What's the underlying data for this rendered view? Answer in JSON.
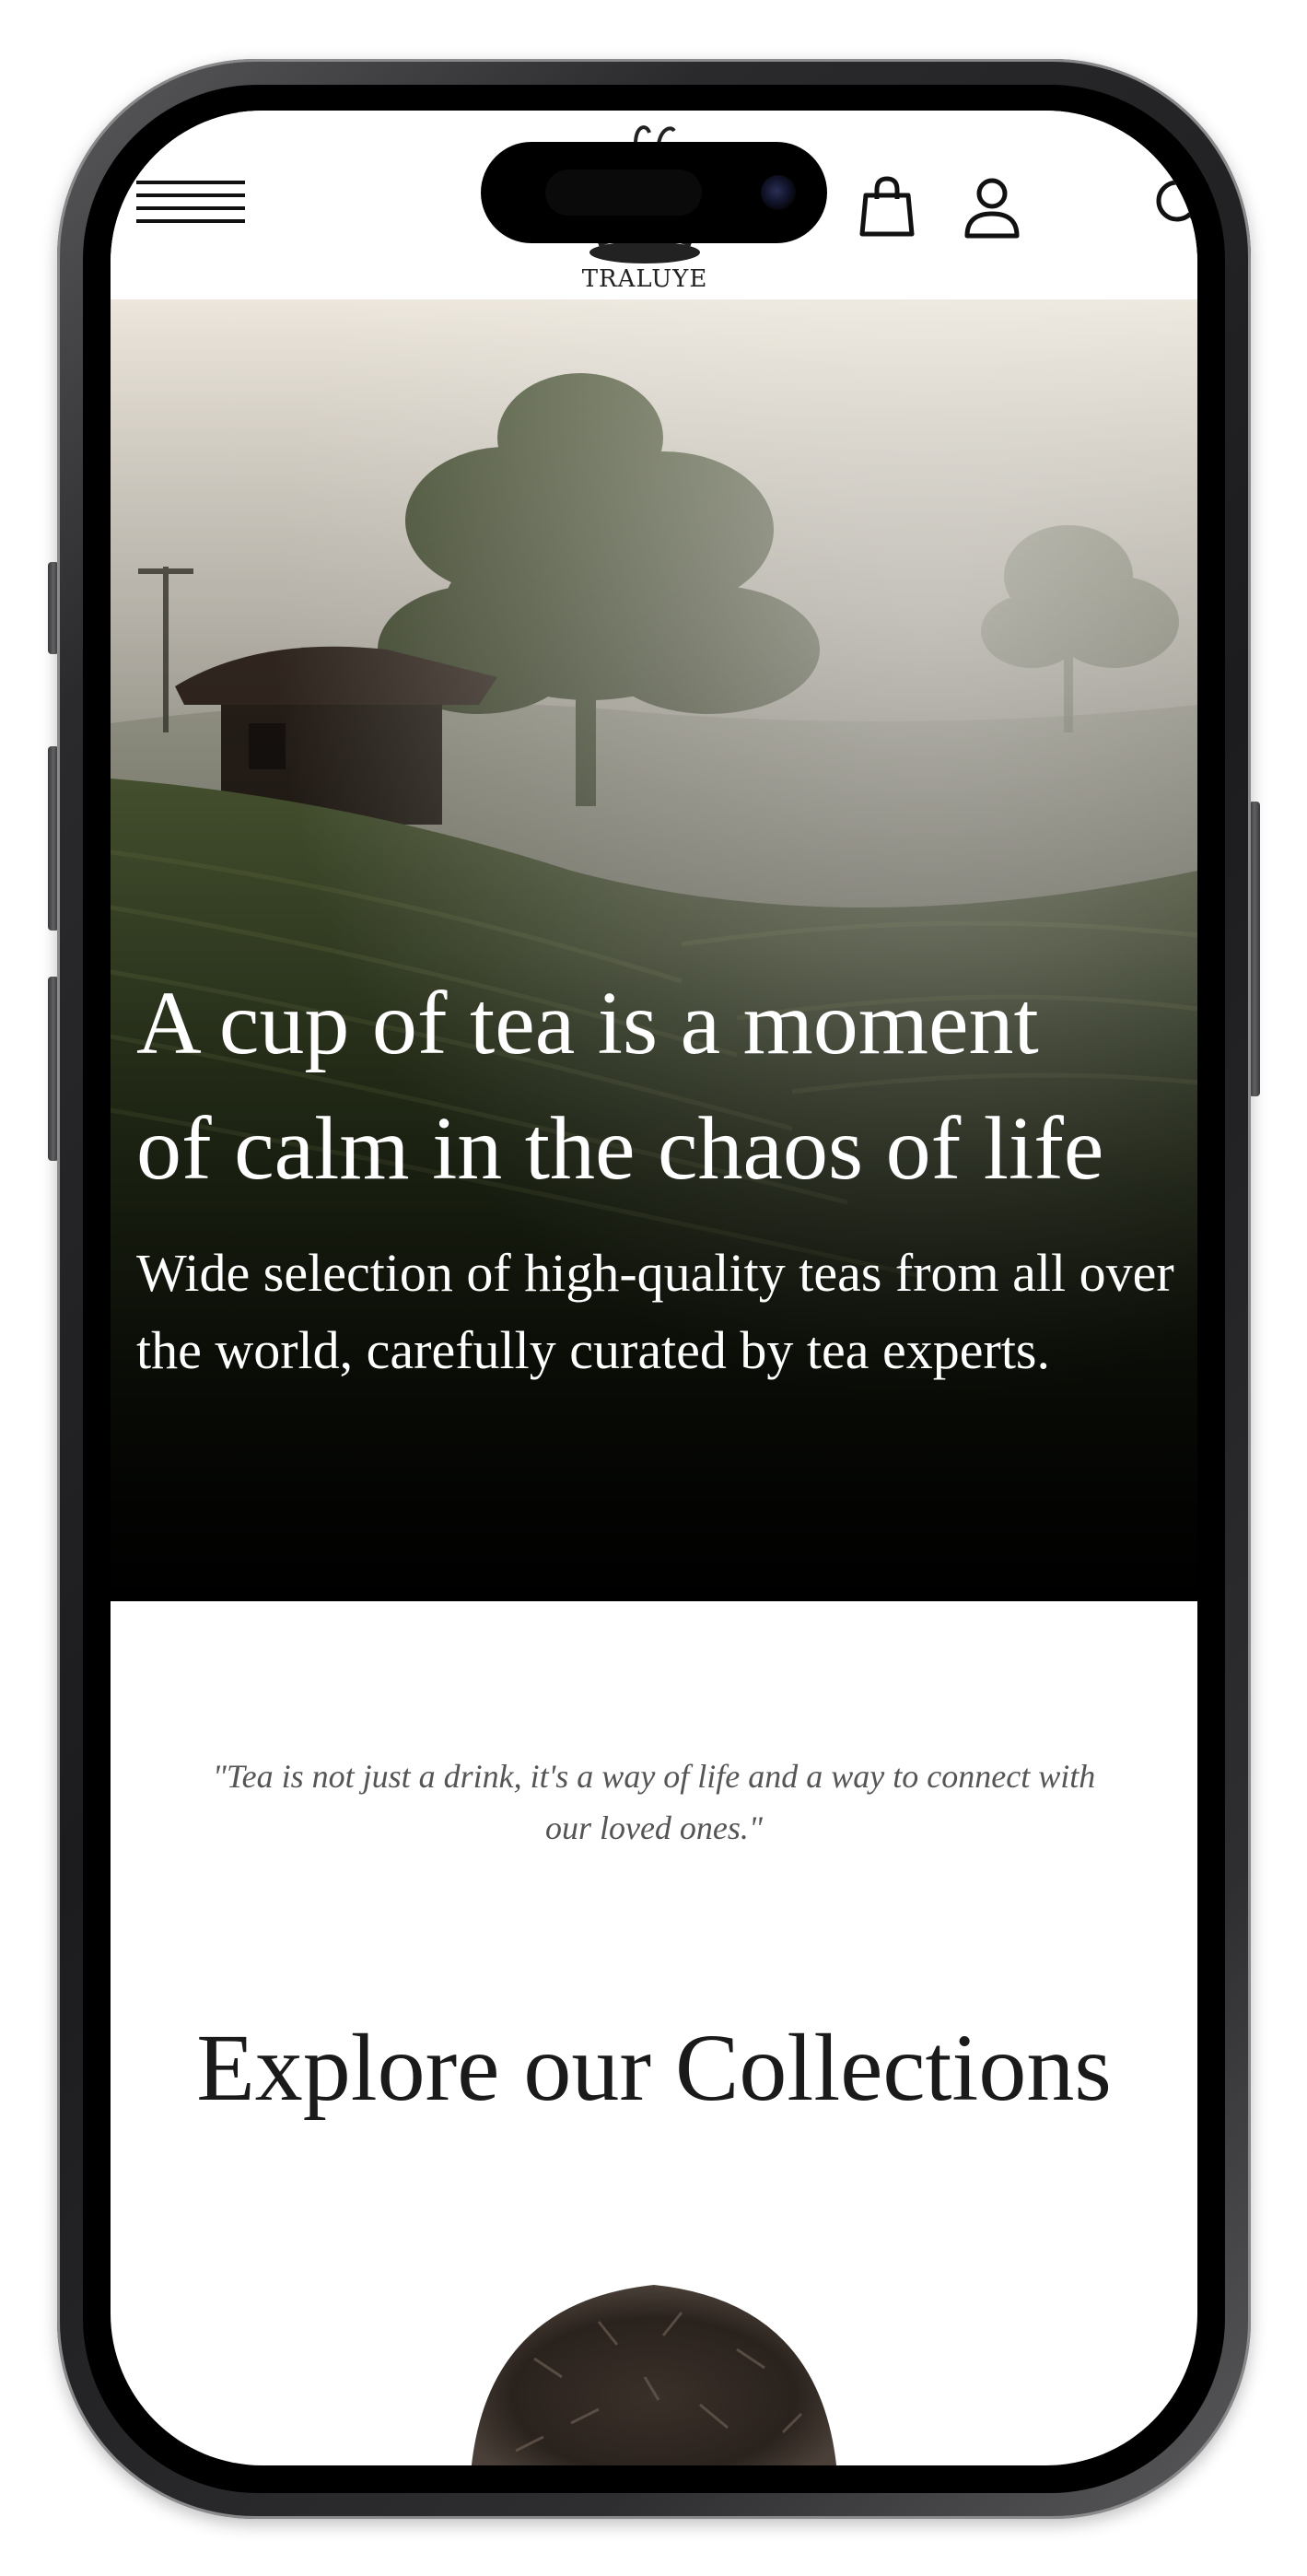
{
  "header": {
    "logo_text": "TRALUYE",
    "menu_icon": "hamburger-menu-icon",
    "cart_icon": "shopping-bag-icon",
    "account_icon": "user-icon",
    "search_icon": "search-icon"
  },
  "hero": {
    "headline": "A cup of tea is a moment\nof calm in the chaos of life",
    "subtext": "Wide selection of high-quality teas from all over the world, carefully curated by tea experts."
  },
  "main": {
    "quote": "\"Tea is not just a drink, it's a way of life and a way to connect with our loved ones.\"",
    "collections_title": "Explore our Collections"
  },
  "colors": {
    "page_background": "#ffffff",
    "hero_text": "#ffffff",
    "phone_frame": "#1c1c1e",
    "title_text": "#1a1a1a",
    "quote_text": "#555555"
  }
}
